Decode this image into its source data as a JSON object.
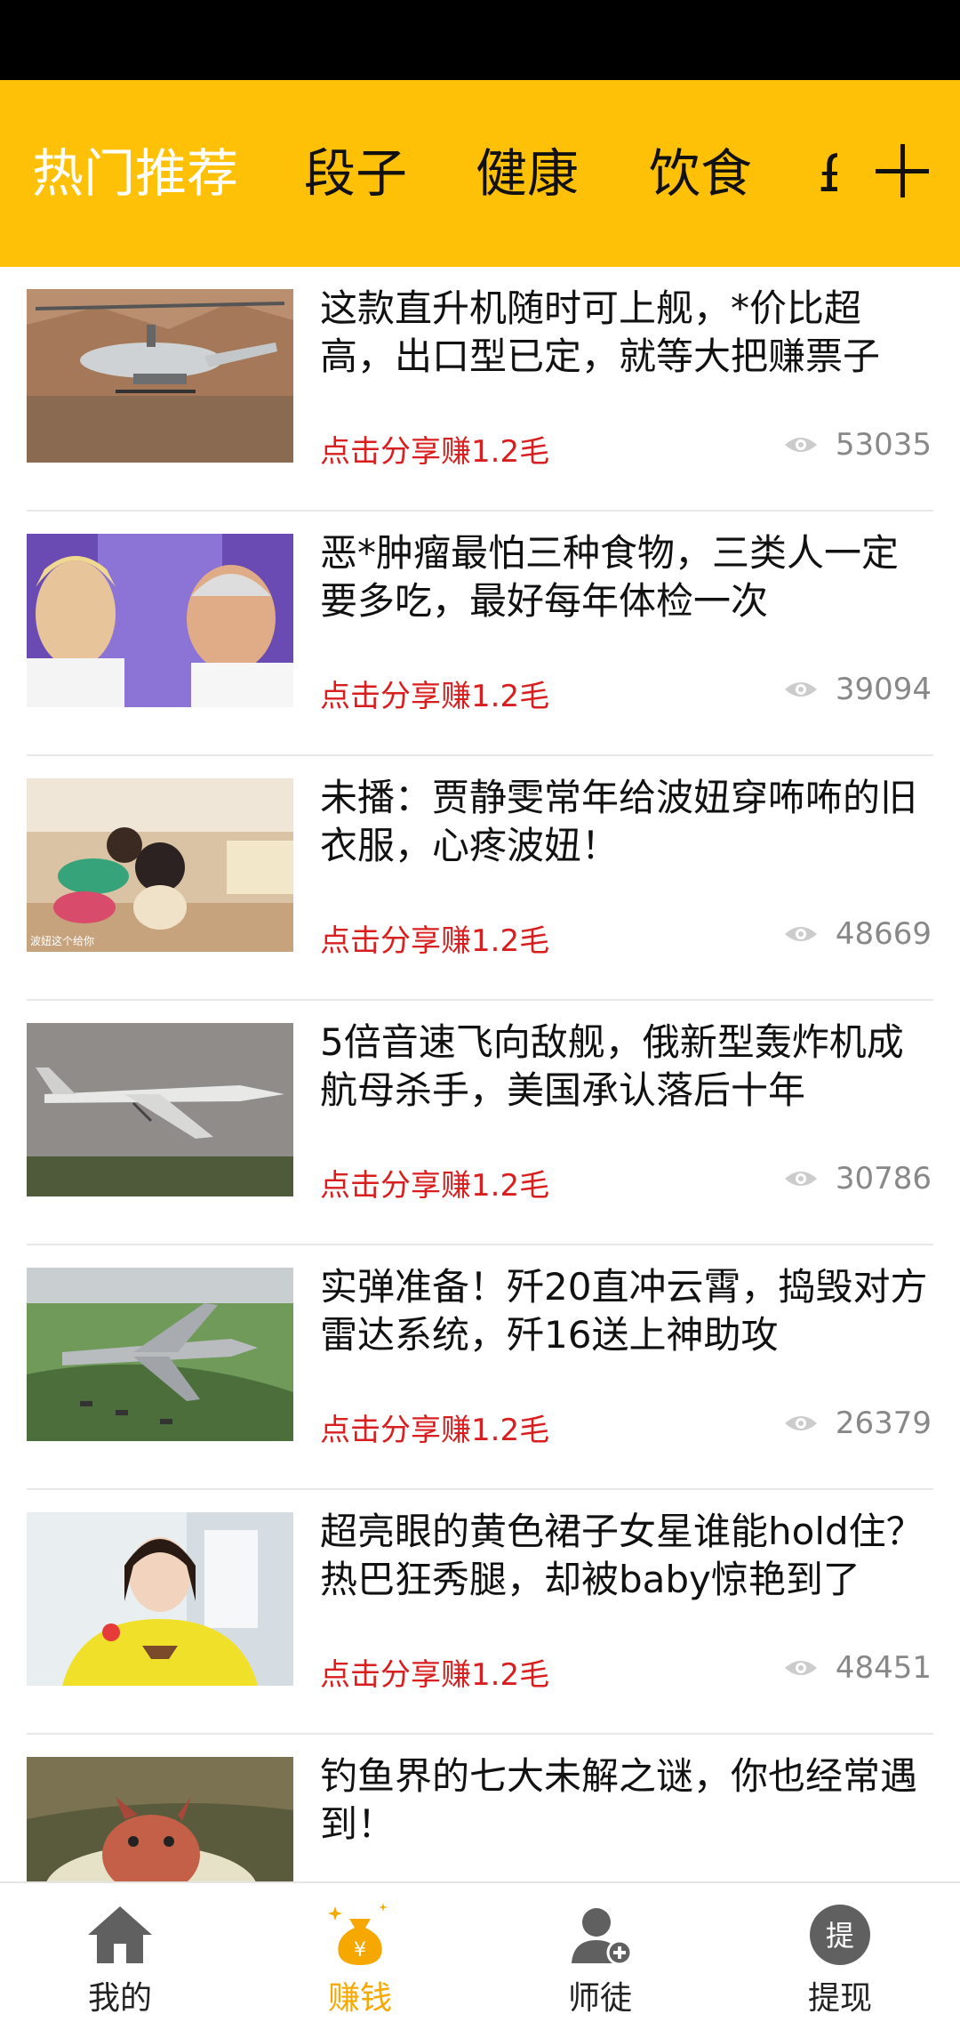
{
  "tabs": {
    "items": [
      "热门推荐",
      "段子",
      "健康",
      "饮食",
      "£"
    ],
    "active": "热门推荐",
    "add_icon": "plus-icon"
  },
  "news": [
    {
      "title": "这款直升机随时可上舰，*价比超高，出口型已定，就等大把赚票子",
      "earn": "点击分享赚1.2毛",
      "views": "53035"
    },
    {
      "title": "恶*肿瘤最怕三种食物，三类人一定要多吃，最好每年体检一次",
      "earn": "点击分享赚1.2毛",
      "views": "39094"
    },
    {
      "title": "未播：贾静雯常年给波妞穿咘咘的旧衣服，心疼波妞！",
      "earn": "点击分享赚1.2毛",
      "views": "48669",
      "thumb_caption": "波妞这个给你"
    },
    {
      "title": "5倍音速飞向敌舰，俄新型轰炸机成航母杀手，美国承认落后十年",
      "earn": "点击分享赚1.2毛",
      "views": "30786"
    },
    {
      "title": "实弹准备！歼20直冲云霄，捣毁对方雷达系统，歼16送上神助攻",
      "earn": "点击分享赚1.2毛",
      "views": "26379"
    },
    {
      "title": "超亮眼的黄色裙子女星谁能hold住？热巴狂秀腿，却被baby惊艳到了",
      "earn": "点击分享赚1.2毛",
      "views": "48451"
    },
    {
      "title": "钓鱼界的七大未解之谜，你也经常遇到！",
      "earn": "",
      "views": ""
    }
  ],
  "bottom_nav": [
    {
      "label": "我的",
      "icon": "home-icon"
    },
    {
      "label": "赚钱",
      "icon": "money-bag-icon",
      "active": true
    },
    {
      "label": "师徒",
      "icon": "add-user-icon"
    },
    {
      "label": "提现",
      "icon": "withdraw-icon",
      "icon_text": "提"
    }
  ],
  "colors": {
    "accent": "#FFC107",
    "earn": "#d81e1e",
    "nav_active": "#F6A800"
  }
}
